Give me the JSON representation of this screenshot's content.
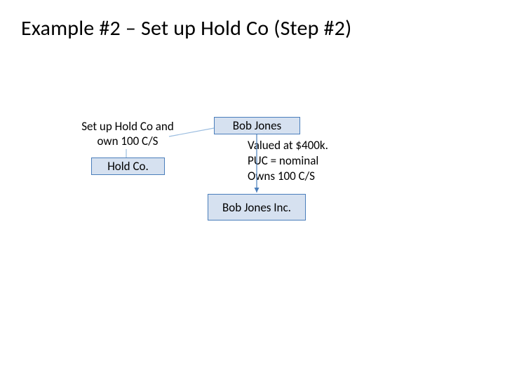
{
  "title": "Example #2 – Set up Hold Co (Step #2)",
  "caption": {
    "line1": "Set up Hold Co and",
    "line2": "own 100 C/S"
  },
  "boxes": {
    "bob_jones": "Bob Jones",
    "hold_co": "Hold Co.",
    "bob_jones_inc": "Bob Jones Inc."
  },
  "annotation": {
    "line1": "Valued at $400k.",
    "line2": "PUC = nominal",
    "line3": "Owns 100 C/S"
  }
}
